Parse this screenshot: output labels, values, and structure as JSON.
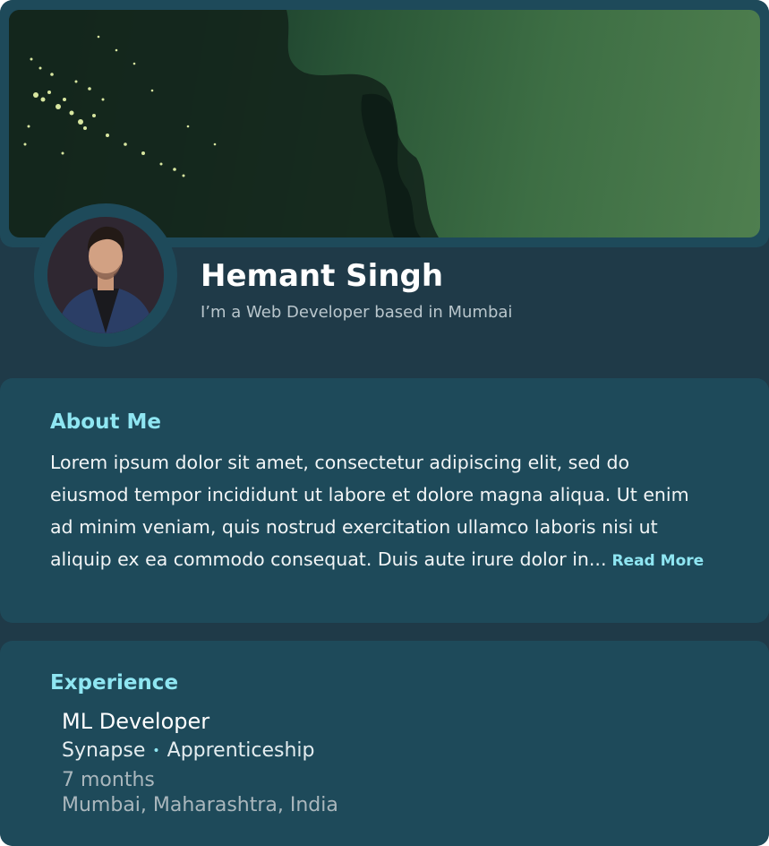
{
  "profile": {
    "name": "Hemant Singh",
    "tagline": "I’m a Web Developer based in Mumbai"
  },
  "about": {
    "title": "About Me",
    "text": "Lorem ipsum dolor sit amet, consectetur adipiscing elit, sed do eiusmod tempor incididunt ut labore et dolore magna aliqua. Ut enim ad minim veniam, quis nostrud exercitation ullamco laboris nisi ut aliquip ex ea commodo consequat. Duis aute irure dolor in...",
    "read_more": "Read More"
  },
  "experience": {
    "title": "Experience",
    "items": [
      {
        "role": "ML Developer",
        "company": "Synapse",
        "separator": "•",
        "type": "Apprenticeship",
        "duration": "7 months",
        "location": "Mumbai, Maharashtra, India"
      }
    ]
  },
  "colors": {
    "card_bg": "#1f3a48",
    "section_bg": "#1e4a5a",
    "accent": "#8fe6f2"
  },
  "icons": {
    "banner": "satellite-map-banner",
    "avatar": "profile-photo"
  }
}
